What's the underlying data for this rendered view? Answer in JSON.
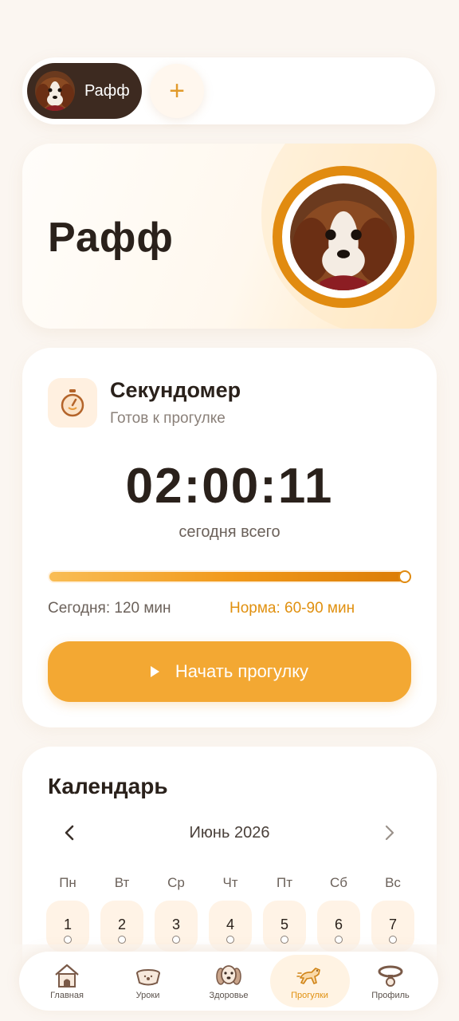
{
  "pet_switcher": {
    "active_pet_name": "Рафф",
    "add_label": "+"
  },
  "hero": {
    "pet_name": "Рафф"
  },
  "stopwatch": {
    "title": "Секундомер",
    "status": "Готов к прогулке",
    "time": "02:00:11",
    "caption": "сегодня всего",
    "progress_fraction": 1.0,
    "today_label": "Сегодня: 120 мин",
    "norm_label": "Норма: 60-90 мин",
    "start_button_label": "Начать прогулку"
  },
  "calendar": {
    "title": "Календарь",
    "month_label": "Июнь 2026",
    "weekdays": [
      "Пн",
      "Вт",
      "Ср",
      "Чт",
      "Пт",
      "Сб",
      "Вс"
    ],
    "days": [
      "1",
      "2",
      "3",
      "4",
      "5",
      "6",
      "7"
    ]
  },
  "nav": {
    "items": [
      {
        "label": "Главная",
        "icon": "doghouse-icon"
      },
      {
        "label": "Уроки",
        "icon": "dog-bowl-icon"
      },
      {
        "label": "Здоровье",
        "icon": "dog-face-icon"
      },
      {
        "label": "Прогулки",
        "icon": "running-dog-icon",
        "active": true
      },
      {
        "label": "Профиль",
        "icon": "collar-icon"
      }
    ]
  },
  "colors": {
    "accent": "#f3a833",
    "accent_dark": "#e18b10",
    "chip_bg": "#3d2a20",
    "background": "#fbf6f1"
  }
}
